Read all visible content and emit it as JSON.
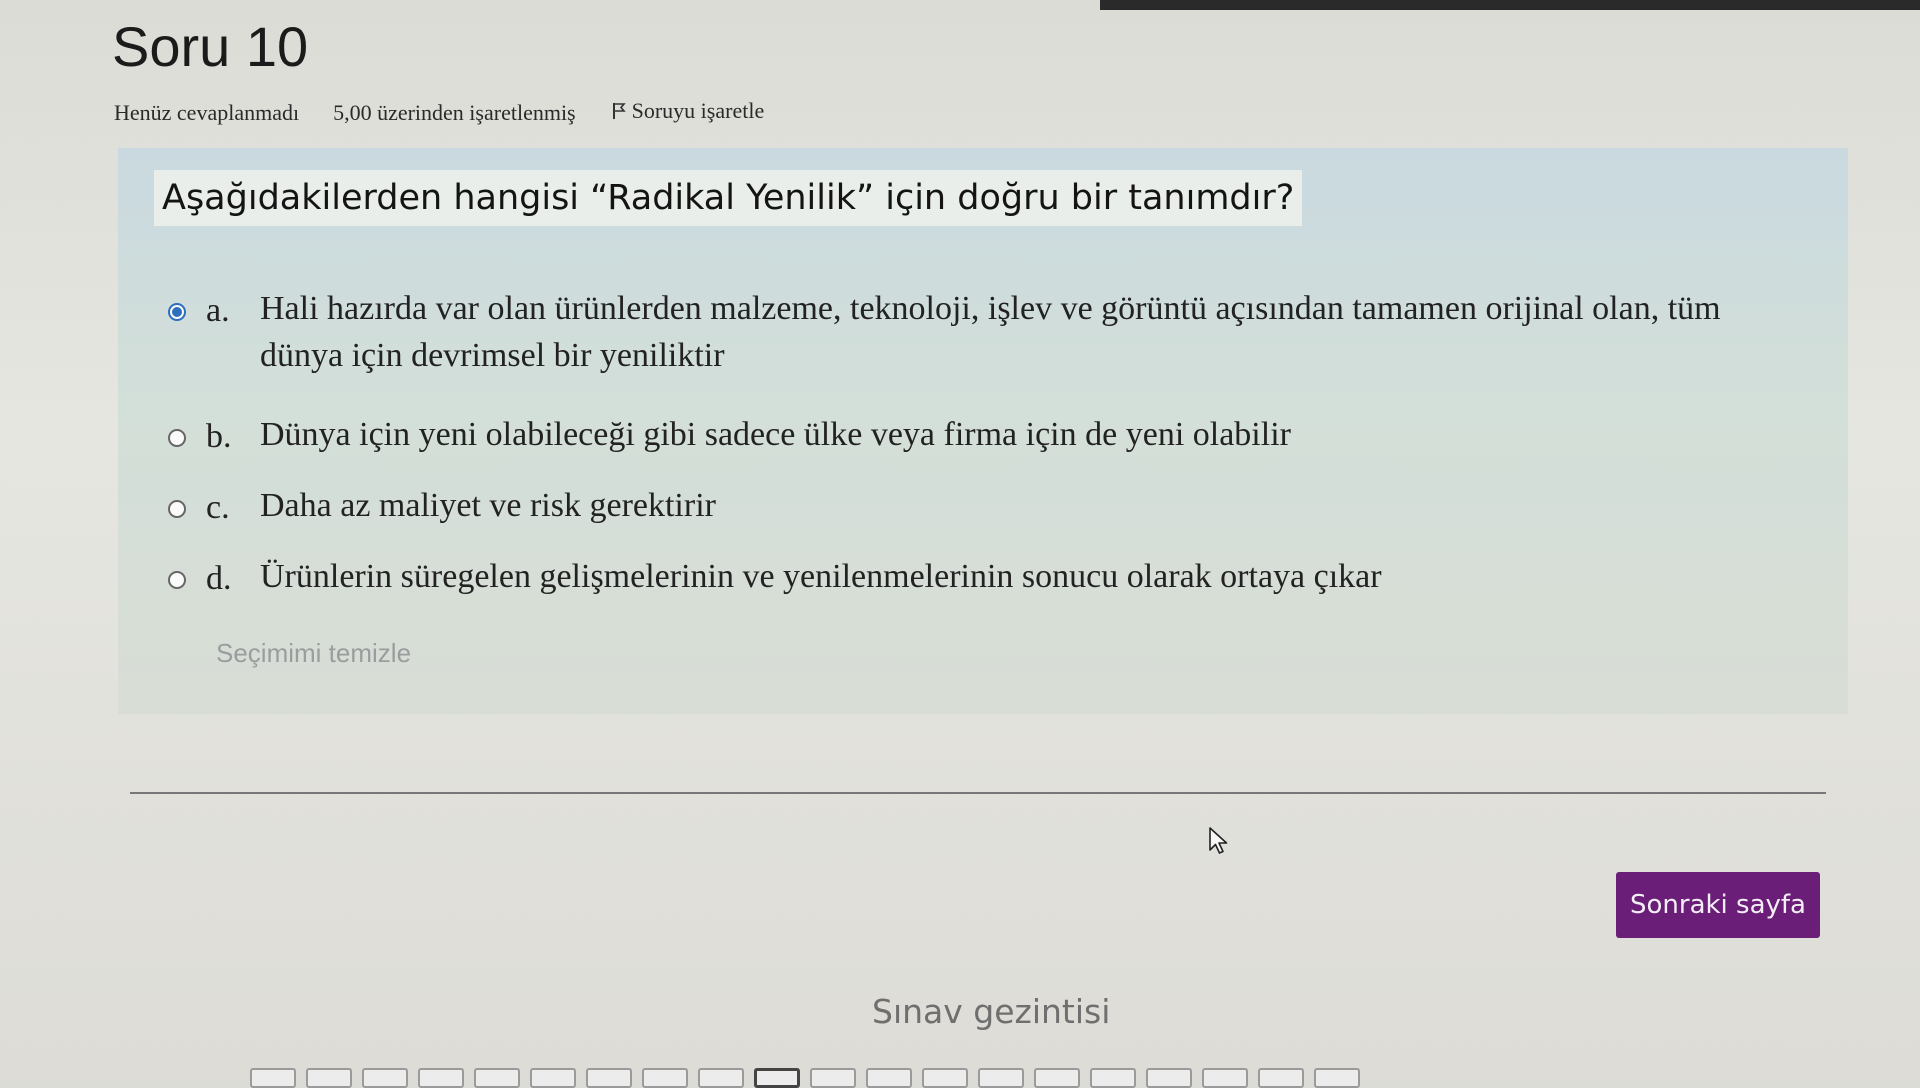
{
  "question": {
    "title": "Soru 10",
    "state": "Henüz cevaplanmadı",
    "grade": "5,00 üzerinden işaretlenmiş",
    "flag_label": "Soruyu işaretle",
    "text": "Aşağıdakilerden hangisi “Radikal Yenilik” için doğru bir tanımdır?",
    "answers": [
      {
        "letter": "a.",
        "text": "Hali hazırda var olan ürünlerden malzeme, teknoloji, işlev ve görüntü açısından tamamen orijinal olan, tüm dünya için devrimsel bir yeniliktir",
        "selected": true
      },
      {
        "letter": "b.",
        "text": "Dünya için yeni olabileceği gibi sadece ülke veya firma için de yeni olabilir",
        "selected": false
      },
      {
        "letter": "c.",
        "text": "Daha az maliyet ve risk gerektirir",
        "selected": false
      },
      {
        "letter": "d.",
        "text": "Ürünlerin süregelen gelişmelerinin ve yenilenmelerinin sonucu olarak ortaya çıkar",
        "selected": false
      }
    ],
    "clear_choice": "Seçimimi temizle"
  },
  "navigation": {
    "next_button": "Sonraki sayfa",
    "quiz_nav_title": "Sınav gezintisi",
    "current_question_index": 9
  },
  "colors": {
    "accent": "#6b1e78",
    "radio_selected": "#2c6fbd",
    "question_box": "#cfdcdb"
  },
  "icons": {
    "flag": "flag-icon",
    "cursor": "mouse-pointer-icon"
  }
}
